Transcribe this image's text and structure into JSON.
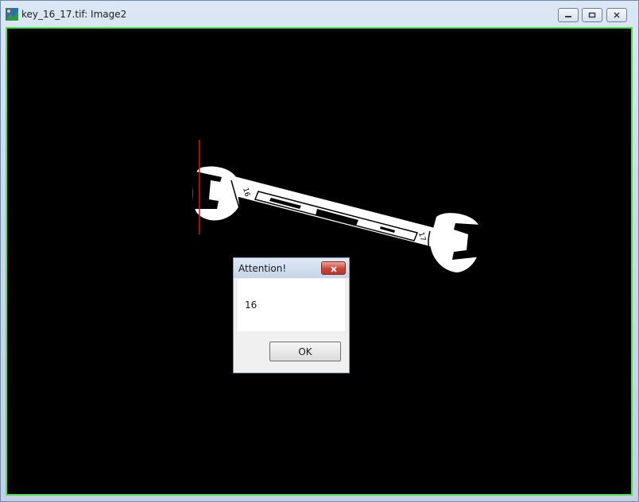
{
  "window": {
    "title": "key_16_17.tif: Image2",
    "controls": {
      "minimize_icon": "minimize-icon",
      "maximize_icon": "maximize-icon",
      "close_icon": "close-icon"
    }
  },
  "image": {
    "subject": "wrench",
    "measure_line_color": "#e01010",
    "border_color": "#4fe04f",
    "wrench_labels": {
      "left_size": "16",
      "right_size": "17"
    }
  },
  "dialog": {
    "title": "Attention!",
    "message": "16",
    "ok_label": "OK"
  }
}
